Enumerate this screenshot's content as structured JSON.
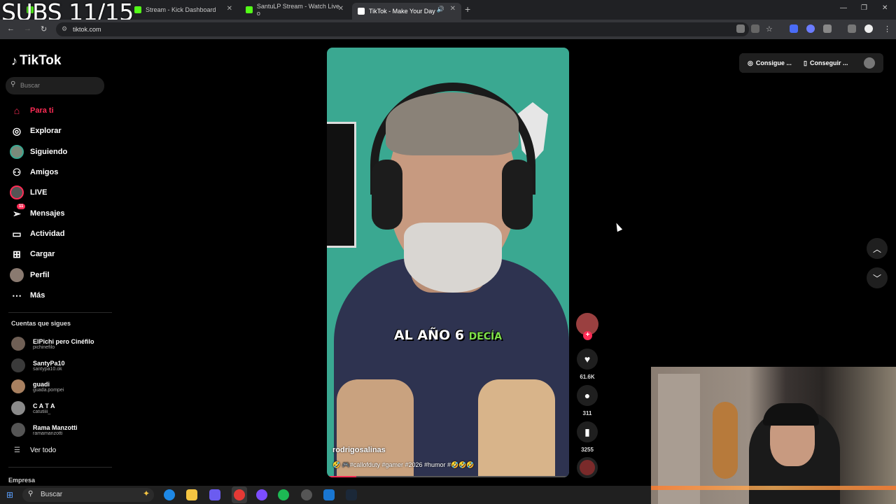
{
  "overlay": {
    "subs": "SUBS 11/15"
  },
  "browser": {
    "tabs": [
      {
        "title": "Stream - Kick Dashboard"
      },
      {
        "title": "SantuLP Stream - Watch Live o"
      },
      {
        "title": "TikTok - Make Your Day"
      }
    ],
    "url": "tiktok.com"
  },
  "sidebar": {
    "logo": "TikTok",
    "search_placeholder": "Buscar",
    "nav": [
      {
        "label": "Para ti",
        "icon": "home-icon"
      },
      {
        "label": "Explorar",
        "icon": "compass-icon"
      },
      {
        "label": "Siguiendo",
        "icon": "avatar"
      },
      {
        "label": "Amigos",
        "icon": "friends-icon"
      },
      {
        "label": "LIVE",
        "icon": "live-icon"
      },
      {
        "label": "Mensajes",
        "icon": "messages-icon",
        "badge": "11"
      },
      {
        "label": "Actividad",
        "icon": "activity-icon"
      },
      {
        "label": "Cargar",
        "icon": "upload-icon"
      },
      {
        "label": "Perfil",
        "icon": "profile-avatar"
      },
      {
        "label": "Más",
        "icon": "more-icon"
      }
    ],
    "following_title": "Cuentas que sigues",
    "following": [
      {
        "name": "ElPichi pero Cinéfilo",
        "handle": "pichinefilo"
      },
      {
        "name": "SantyPa10",
        "handle": "santypa10.ok"
      },
      {
        "name": "guadi",
        "handle": "guada.pompei"
      },
      {
        "name": "C A T A",
        "handle": "catutiiii_"
      },
      {
        "name": "Rama Manzotti",
        "handle": "ramamanzotti"
      }
    ],
    "see_all": "Ver todo",
    "empresa": "Empresa"
  },
  "video": {
    "caption_main": "AL AÑO 6",
    "caption_highlight": "DECÍA",
    "author": "rodrigosalinas",
    "description": "🤣 🎮#callofduty #gamer #2026 #humor #🤣🤣🤣",
    "progress": 0.12
  },
  "actions": {
    "likes": "61.6K",
    "comments": "311",
    "saves": "3255"
  },
  "topright": {
    "btn1": "Consigue ...",
    "btn2": "Conseguir ..."
  },
  "taskbar": {
    "search": "Buscar"
  },
  "colors": {
    "accent": "#fe2c55",
    "video_bg": "#3aa891"
  }
}
